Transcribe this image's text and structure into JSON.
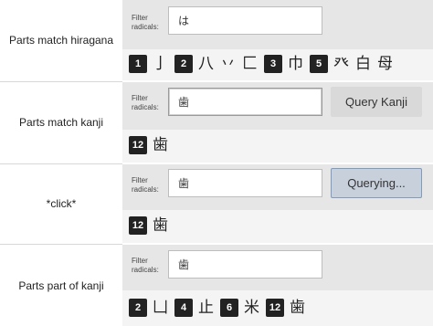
{
  "filter_label": "Filter radicals:",
  "rows": [
    {
      "label": "Parts match hiragana",
      "input_value": "は",
      "button": "",
      "items": [
        {
          "badge": "1",
          "glyphs": [
            "亅"
          ]
        },
        {
          "badge": "2",
          "glyphs": [
            "八",
            "丷",
            "匚"
          ]
        },
        {
          "badge": "3",
          "glyphs": [
            "巾"
          ]
        },
        {
          "badge": "5",
          "glyphs": [
            "癶",
            "白",
            "母"
          ]
        }
      ]
    },
    {
      "label": "Parts match kanji",
      "input_value": "歯",
      "button": "Query Kanji",
      "items": [
        {
          "badge": "12",
          "glyphs": [
            "歯"
          ]
        }
      ]
    },
    {
      "label": "*click*",
      "input_value": "歯",
      "button": "Querying...",
      "items": [
        {
          "badge": "12",
          "glyphs": [
            "歯"
          ]
        }
      ]
    },
    {
      "label": "Parts part of kanji",
      "input_value": "歯",
      "button": "",
      "items": [
        {
          "badge": "2",
          "glyphs": [
            "凵"
          ]
        },
        {
          "badge": "4",
          "glyphs": [
            "止"
          ]
        },
        {
          "badge": "6",
          "glyphs": [
            "米"
          ]
        },
        {
          "badge": "12",
          "glyphs": [
            "歯"
          ]
        }
      ]
    }
  ]
}
